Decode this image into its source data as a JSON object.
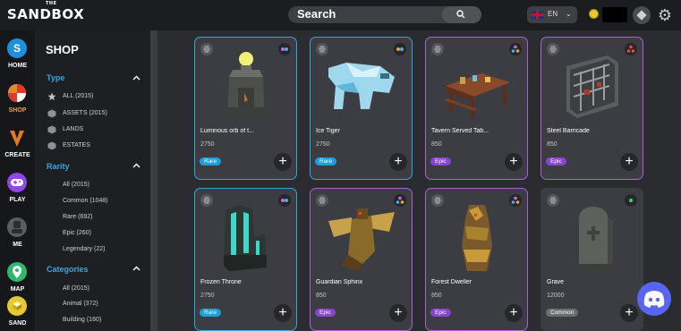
{
  "header": {
    "logo_small": "THE",
    "logo_text": "SANDBOX",
    "search_label": "Search",
    "language": "EN",
    "icons": [
      "search-icon",
      "uk-flag-icon",
      "chevron-down-icon",
      "coin-icon",
      "diamond-icon",
      "gear-icon"
    ]
  },
  "nav": {
    "items": [
      {
        "label": "HOME",
        "icon": "sandbox-logo-icon",
        "color": "#1f8fe0"
      },
      {
        "label": "SHOP",
        "icon": "shop-icon",
        "color": "#e06a2a"
      },
      {
        "label": "CREATE",
        "icon": "create-icon",
        "color": "#16171a"
      },
      {
        "label": "PLAY",
        "icon": "gamepad-icon",
        "color": "#9147e6"
      },
      {
        "label": "ME",
        "icon": "avatar-icon",
        "color": "#5a5c60"
      },
      {
        "label": "MAP",
        "icon": "map-pin-icon",
        "color": "#2dbb6b"
      },
      {
        "label": "SAND",
        "icon": "sand-icon",
        "color": "#e8c830"
      }
    ]
  },
  "sidebar": {
    "title": "SHOP",
    "type": {
      "title": "Type",
      "items": [
        "ALL (2015)",
        "ASSETS (2015)",
        "LANDS",
        "ESTATES"
      ]
    },
    "rarity": {
      "title": "Rarity",
      "items": [
        "All (2015)",
        "Common (1048)",
        "Rare (692)",
        "Epic (260)",
        "Legendary (22)"
      ]
    },
    "categories": {
      "title": "Categories",
      "items": [
        "All (2015)",
        "Animal (372)",
        "Building (160)"
      ]
    }
  },
  "cards": [
    {
      "name": "Luminous orb of t...",
      "price": "2750",
      "rarity": "Rare",
      "art": "orb-tower-icon"
    },
    {
      "name": "Ice Tiger",
      "price": "2750",
      "rarity": "Rare",
      "art": "ice-tiger-icon"
    },
    {
      "name": "Tavern Served Tab...",
      "price": "850",
      "rarity": "Epic",
      "art": "tavern-table-icon"
    },
    {
      "name": "Steel Barricade",
      "price": "850",
      "rarity": "Epic",
      "art": "steel-barricade-icon"
    },
    {
      "name": "Frozen Throne",
      "price": "2750",
      "rarity": "Rare",
      "art": "frozen-throne-icon"
    },
    {
      "name": "Guardian Sphinx",
      "price": "850",
      "rarity": "Epic",
      "art": "guardian-sphinx-icon"
    },
    {
      "name": "Forest Dweller",
      "price": "850",
      "rarity": "Epic",
      "art": "forest-dweller-icon"
    },
    {
      "name": "Grave",
      "price": "12000",
      "rarity": "Common",
      "art": "gravestone-icon"
    }
  ],
  "colors": {
    "rare": "#1e9fd8",
    "epic": "#8a45cf",
    "common": "#6c6e72",
    "accent_blue": "#37a6e8",
    "shop_active": "#e8a23a",
    "discord": "#5865f2"
  },
  "discord_icon": "discord-icon"
}
